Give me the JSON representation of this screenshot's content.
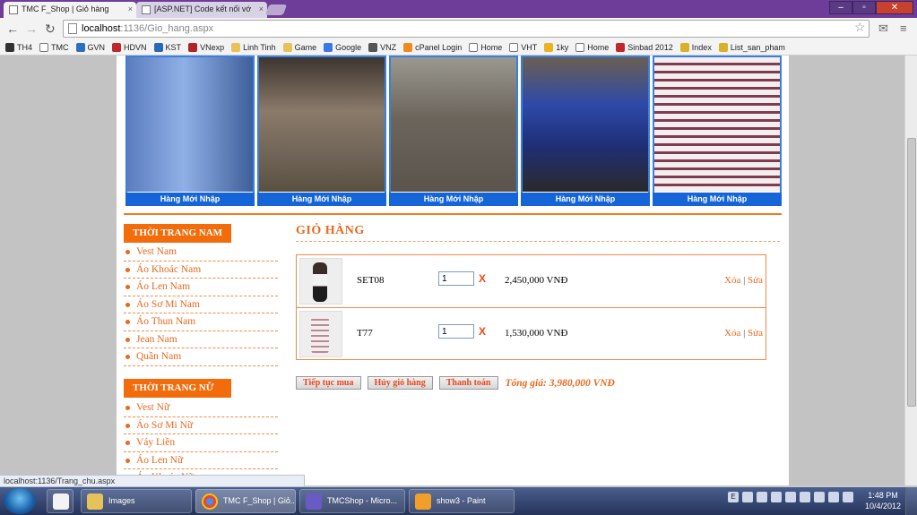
{
  "browser": {
    "tabs": [
      {
        "title": "TMC F_Shop | Giỏ hàng",
        "active": true
      },
      {
        "title": "[ASP.NET] Code kết nối vớ",
        "active": false
      }
    ],
    "url_host": "localhost",
    "url_path": ":1136/Gio_hang.aspx",
    "bookmarks": [
      "TH4",
      "TMC",
      "GVN",
      "HDVN",
      "KST",
      "VNexp",
      "Linh Tinh",
      "Game",
      "Google",
      "VNZ",
      "cPanel Login",
      "Home",
      "VHT",
      "1ky",
      "Home",
      "Sinbad 2012",
      "Index",
      "List_san_pham"
    ],
    "status_url": "localhost:1136/Trang_chu.aspx"
  },
  "banner": {
    "captions": [
      "Hàng Mới Nhập",
      "Hàng Mới Nhập",
      "Hàng Mới Nhập",
      "Hàng Mới Nhập",
      "Hàng Mới Nhập"
    ]
  },
  "menu_men": {
    "title": "THỜI TRANG NAM",
    "items": [
      "Vest Nam",
      "Áo Khoác Nam",
      "Áo Len Nam",
      "Áo Sơ Mi Nam",
      "Áo Thun Nam",
      "Jean Nam",
      "Quần Nam"
    ]
  },
  "menu_women": {
    "title": "THỜI TRANG NỮ",
    "items": [
      "Vest Nữ",
      "Áo Sơ Mi Nữ",
      "Váy Liền",
      "Áo Len Nữ",
      "Áo Khoác Nữ"
    ]
  },
  "cart": {
    "title": "GIỎ HÀNG",
    "rows": [
      {
        "code": "SET08",
        "qty": "1",
        "remove": "X",
        "price": "2,450,000 VNĐ",
        "delete": "Xóa",
        "sep": "|",
        "edit": "Sửa"
      },
      {
        "code": "T77",
        "qty": "1",
        "remove": "X",
        "price": "1,530,000 VNĐ",
        "delete": "Xóa",
        "sep": "|",
        "edit": "Sửa"
      }
    ],
    "continue_label": "Tiếp tục mua",
    "clear_label": "Hủy giỏ hàng",
    "checkout_label": "Thanh toán",
    "total": "Tổng giá: 3,980,000 VNĐ"
  },
  "taskbar": {
    "items": [
      "Images",
      "TMC F_Shop | Giỏ...",
      "TMCShop - Micro...",
      "show3 - Paint"
    ],
    "time": "1:48 PM",
    "date": "10/4/2012"
  },
  "colors": {
    "accent": "#f36c0c",
    "banner_blue": "#1565d8"
  }
}
